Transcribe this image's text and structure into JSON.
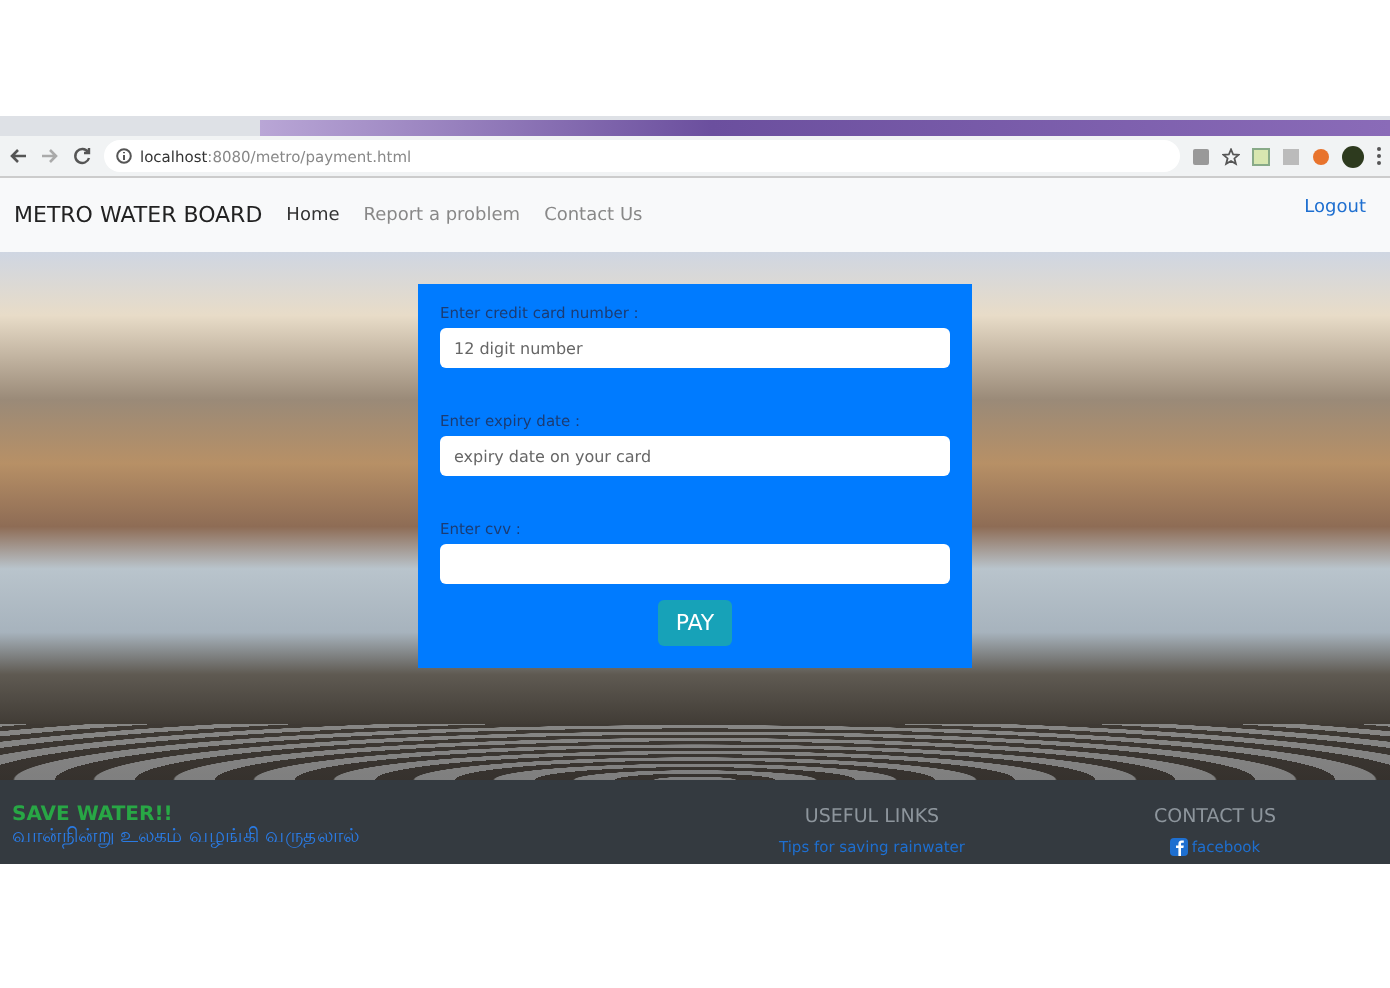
{
  "browser": {
    "url_host": "localhost",
    "url_path": ":8080/metro/payment.html"
  },
  "navbar": {
    "brand": "METRO WATER BOARD",
    "links": [
      {
        "label": "Home",
        "selected": true
      },
      {
        "label": "Report a problem",
        "selected": false
      },
      {
        "label": "Contact Us",
        "selected": false
      }
    ],
    "logout": "Logout"
  },
  "form": {
    "fields": [
      {
        "label": "Enter credit card number :",
        "placeholder": "12 digit number"
      },
      {
        "label": "Enter expiry date :",
        "placeholder": "expiry date on your card"
      },
      {
        "label": "Enter cvv :"
      }
    ],
    "button": "PAY"
  },
  "footer": {
    "title": "SAVE WATER!!",
    "quote": "வான்நின்று உலகம் வழங்கி வருதலால்",
    "useful_heading": "USEFUL LINKS",
    "useful_links": [
      "Tips for saving rainwater"
    ],
    "contact_heading": "CONTACT US",
    "contact_links": [
      "facebook"
    ]
  }
}
